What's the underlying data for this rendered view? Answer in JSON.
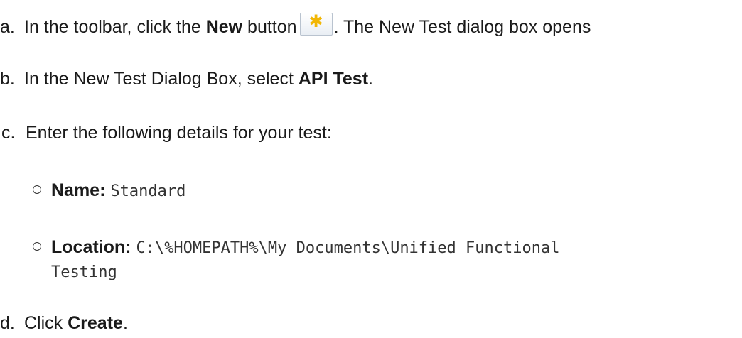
{
  "steps": [
    {
      "marker": "a.",
      "text_before": "In the toolbar, click the ",
      "bold": "New",
      "text_mid": " button",
      "text_after": ". The New Test dialog box opens",
      "icon": "new-star-icon"
    },
    {
      "marker": "b.",
      "text_before": "In the New Test Dialog Box, select ",
      "bold": "API Test",
      "text_after": "."
    },
    {
      "marker": "c.",
      "text": "Enter the following details for your test:"
    },
    {
      "marker": "d.",
      "text_before": "Click ",
      "bold": "Create",
      "text_after": "."
    }
  ],
  "details": [
    {
      "label": "Name:",
      "value": "Standard"
    },
    {
      "label": "Location:",
      "value": "C:\\%HOMEPATH%\\My Documents\\Unified Functional",
      "value_cont": "Testing"
    }
  ],
  "colors": {
    "icon_star": "#f2b705",
    "text": "#1a1a1a"
  }
}
